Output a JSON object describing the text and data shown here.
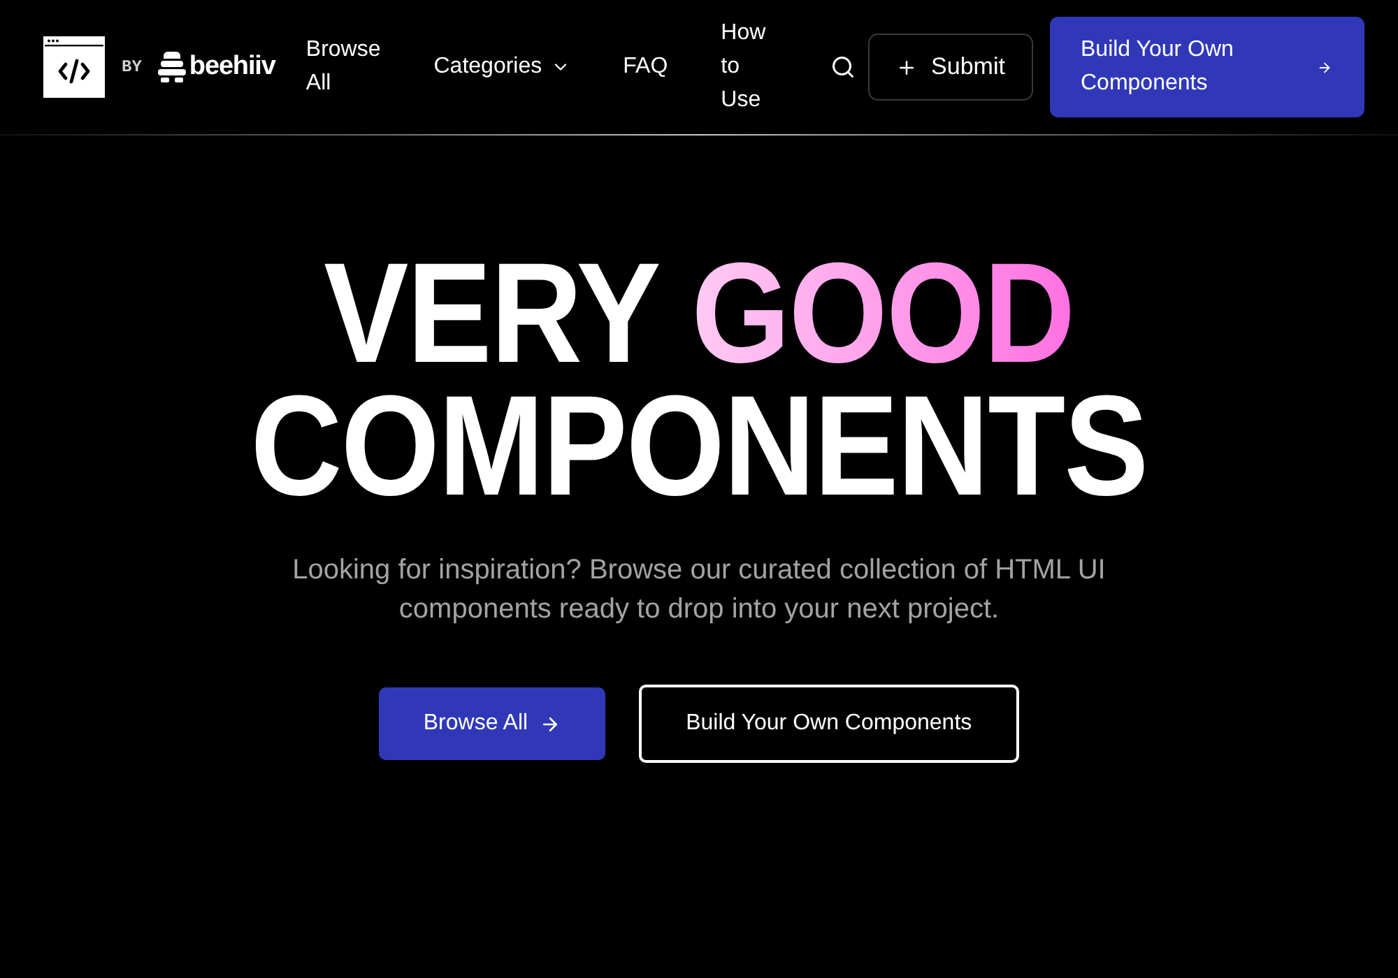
{
  "header": {
    "logo_by": "BY",
    "partner_name": "beehiiv",
    "nav": [
      {
        "label": "Browse All",
        "kind": "link"
      },
      {
        "label": "Categories",
        "kind": "dropdown"
      },
      {
        "label": "FAQ",
        "kind": "link"
      },
      {
        "label": "How to Use",
        "kind": "link"
      }
    ],
    "submit_button": "Submit",
    "cta_button": "Build Your Own Components"
  },
  "hero": {
    "headline": [
      {
        "text": "VERY",
        "kind": "plain"
      },
      {
        "text": "GOOD",
        "kind": "gradient"
      },
      {
        "text": "COMPONENTS",
        "kind": "plain"
      }
    ],
    "subtitle": "Looking for inspiration? Browse our curated collection of HTML UI components ready to drop into your next project.",
    "buttons": [
      {
        "label": "Browse All",
        "kind": "primary"
      },
      {
        "label": "Build Your Own Components",
        "kind": "outline"
      }
    ]
  }
}
